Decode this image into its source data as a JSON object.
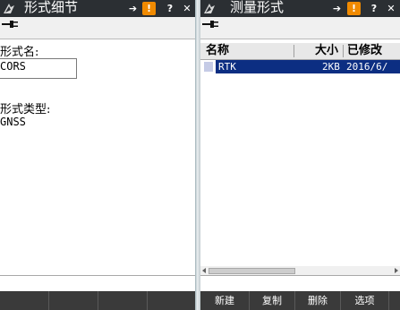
{
  "left": {
    "title": "形式细节",
    "arrow_glyph": "➔",
    "warn_glyph": "!",
    "help_glyph": "?",
    "close_glyph": "✕",
    "name_label": "形式名:",
    "name_value": "CORS",
    "type_label": "形式类型:",
    "type_value": "GNSS"
  },
  "right": {
    "title": "测量形式",
    "arrow_glyph": "➔",
    "warn_glyph": "!",
    "help_glyph": "?",
    "close_glyph": "✕",
    "columns": {
      "name": "名称",
      "size": "大小",
      "modified": "已修改"
    },
    "rows": [
      {
        "name": "RTK",
        "size": "2KB",
        "modified": "2016/6/"
      }
    ],
    "softkeys": [
      "新建",
      "复制",
      "删除",
      "选项"
    ]
  },
  "colors": {
    "titlebar": "#2b2f33",
    "selection": "#0c2e82",
    "warning": "#f08a00",
    "softkey_bar": "#3a3a3a"
  }
}
